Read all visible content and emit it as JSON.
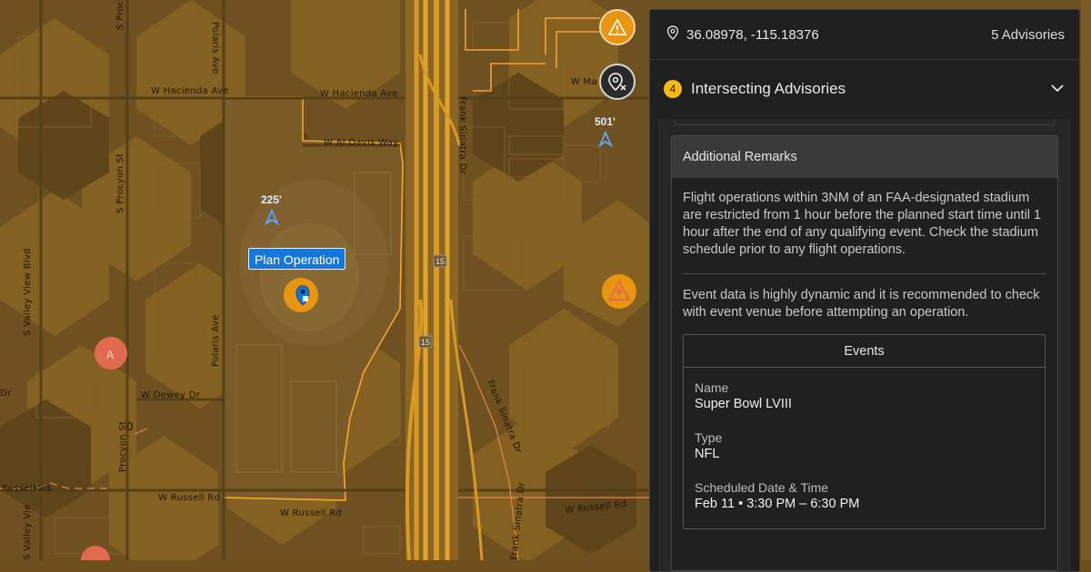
{
  "map": {
    "streets": {
      "w_hacienda_ave_west": "W Hacienda Ave",
      "w_hacienda_ave_east": "W Hacienda Ave",
      "w_al_davis_way": "W Al Davis Way",
      "polaris_ave_north": "Polaris Ave",
      "polaris_ave_south": "Polaris Ave",
      "s_procyon_st_north": "S Procyon St",
      "s_procyon_st_top": "S Proc",
      "procyon_st_south": "Procyon St",
      "s_valley_view_blvd": "S Valley View Blvd",
      "s_valley_view_south": "S Valley Vie",
      "w_dewey_dr": "W Dewey Dr",
      "w_russell_rd_west": "W Russell Rd",
      "w_russell_rd_mid": "W Russell Rd",
      "w_russell_rd_east": "W Russell Rd",
      "russell_rd_edge": "Russell Rd",
      "frank_sinatra_dr_north": "Frank Sinatra Dr",
      "frank_sinatra_dr_mid": "Frank Sinatra Dr",
      "frank_sinatra_dr_south": "Frank Sinatra Dr",
      "w_ma_partial": "W Ma",
      "dr_edge": "Dr"
    },
    "altitudes": {
      "alt_225": "225'",
      "alt_501": "501'"
    },
    "shields": {
      "i15_upper": "15",
      "i15_lower": "15"
    },
    "zero_label": "0",
    "tower_label": "A",
    "plan_operation_label": "Plan Operation",
    "colors": {
      "advisory_orange": "#e8960f",
      "warning_red": "#e46a4e",
      "pin_blue": "#1677d8"
    }
  },
  "panel": {
    "coordinates": "36.08978, -115.18376",
    "advisories_count": "5 Advisories",
    "advisory_badge": "4",
    "advisory_title": "Intersecting Advisories",
    "remarks_title": "Additional Remarks",
    "paragraph1": "Flight operations within 3NM of an FAA-designated stadium are restricted from 1 hour before the planned start time until 1 hour after the end of any qualifying event. Check the stadium schedule prior to any flight operations.",
    "paragraph2": "Event data is highly dynamic and it is recommended to check with event venue before attempting an operation.",
    "events": {
      "title": "Events",
      "name_label": "Name",
      "name_value": "Super Bowl LVIII",
      "type_label": "Type",
      "type_value": "NFL",
      "datetime_label": "Scheduled Date & Time",
      "datetime_value": "Feb 11 • 3:30 PM – 6:30 PM"
    }
  },
  "icons": {
    "coord_pin": "location-pin-icon",
    "chevron": "chevron-down-icon",
    "warning": "warning-triangle-icon",
    "location_off": "location-cancel-icon",
    "lightning": "lightning-hazard-icon",
    "drone_pin": "drone-location-pin-icon",
    "tower": "radio-tower-icon",
    "airplane": "airplane-marker-icon"
  }
}
